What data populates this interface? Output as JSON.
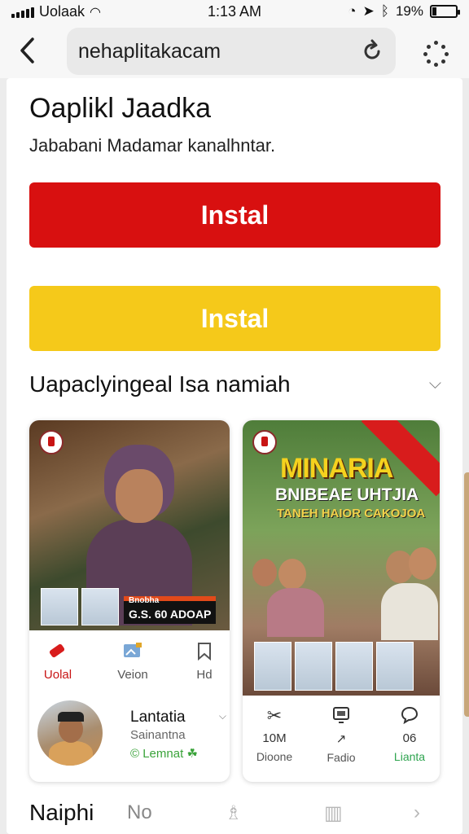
{
  "status_bar": {
    "carrier": "Uolaak",
    "time": "1:13 AM",
    "battery": "19%",
    "battery_level": 0.19
  },
  "browser": {
    "url": "nehaplitakacam",
    "back_icon": "chevron-left-icon",
    "reload_icon": "reload-icon",
    "menu_icon": "more-dots-icon"
  },
  "page": {
    "title": "Oaplikl Jaadka",
    "subtitle": "Jababani Madamar kanalhntar.",
    "install_primary": "Instal",
    "install_secondary": "Instal",
    "colors": {
      "primary_button": "#d81010",
      "secondary_button": "#f5c91a",
      "accent_green": "#2ea44f"
    }
  },
  "section": {
    "header": "Uapaclyingeal Isa namiah"
  },
  "video_cards": [
    {
      "caption_tag": "Bnobha",
      "caption": "G.S. 60 ADOAP",
      "actions": [
        {
          "icon": "tag-icon",
          "label": "Uolal"
        },
        {
          "icon": "image-edit-icon",
          "label": "Veion"
        },
        {
          "icon": "bookmark-icon",
          "label": "Hd"
        }
      ],
      "channel": {
        "name": "Lantatia",
        "sub": "Sainantna",
        "status": "© Lemnat"
      }
    },
    {
      "poster_title": "MINARIA",
      "poster_sub1": "BNIBEAE UHTJIA",
      "poster_sub2": "TANEH HAIOR CAKOJOA",
      "actions": [
        {
          "icon": "scissors-icon",
          "value": "10M",
          "label": "Dioone"
        },
        {
          "icon": "cast-icon",
          "value": "",
          "label": "Fadio"
        },
        {
          "icon": "comment-icon",
          "value": "06",
          "label": "Lianta"
        }
      ]
    }
  ],
  "bottom_nav": {
    "title": "Naiphi",
    "item2": "No"
  }
}
